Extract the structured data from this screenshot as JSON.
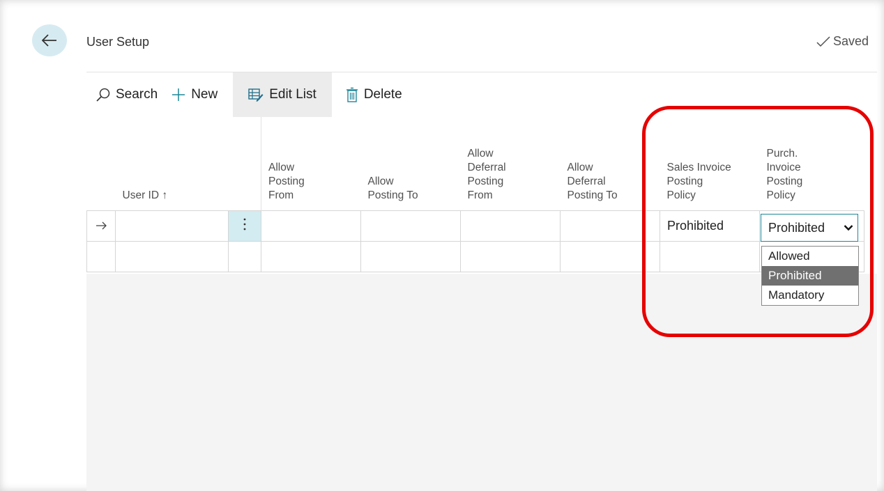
{
  "page": {
    "title": "User Setup",
    "saved_label": "Saved"
  },
  "toolbar": {
    "search_label": "Search",
    "new_label": "New",
    "edit_list_label": "Edit List",
    "delete_label": "Delete"
  },
  "grid": {
    "headers": {
      "user_id": "User ID ↑",
      "allow_posting_from": [
        "Allow",
        "Posting",
        "From"
      ],
      "allow_posting_to": [
        "Allow",
        "Posting To"
      ],
      "allow_deferral_posting_from": [
        "Allow",
        "Deferral",
        "Posting",
        "From"
      ],
      "allow_deferral_posting_to": [
        "Allow",
        "Deferral",
        "Posting To"
      ],
      "sales_invoice_posting_policy": [
        "Sales Invoice",
        "Posting",
        "Policy"
      ],
      "purch_invoice_posting_policy": [
        "Purch.",
        "Invoice",
        "Posting",
        "Policy"
      ]
    },
    "rows": [
      {
        "user_id": "",
        "allow_posting_from": "",
        "allow_posting_to": "",
        "allow_deferral_posting_from": "",
        "allow_deferral_posting_to": "",
        "sales_invoice_posting_policy": "Prohibited",
        "purch_invoice_posting_policy": "Prohibited"
      },
      {
        "user_id": "",
        "allow_posting_from": "",
        "allow_posting_to": "",
        "allow_deferral_posting_from": "",
        "allow_deferral_posting_to": "",
        "sales_invoice_posting_policy": "",
        "purch_invoice_posting_policy": ""
      }
    ]
  },
  "dropdown": {
    "options": [
      "Allowed",
      "Prohibited",
      "Mandatory"
    ],
    "selected": "Prohibited"
  },
  "icons": {
    "back": "back-arrow-icon",
    "saved": "checkmark-icon",
    "search": "search-icon",
    "new": "plus-icon",
    "edit_list": "edit-list-icon",
    "delete": "trash-icon",
    "row_indicator": "right-arrow-icon",
    "row_actions": "more-vertical-icon",
    "dropdown": "chevron-down-icon"
  },
  "colors": {
    "accent": "#1f8799",
    "back_button_bg": "#d6ebf1",
    "row_actions_bg": "#d3ecf1",
    "highlight": "#e60000",
    "dropdown_selected_bg": "#707070"
  }
}
